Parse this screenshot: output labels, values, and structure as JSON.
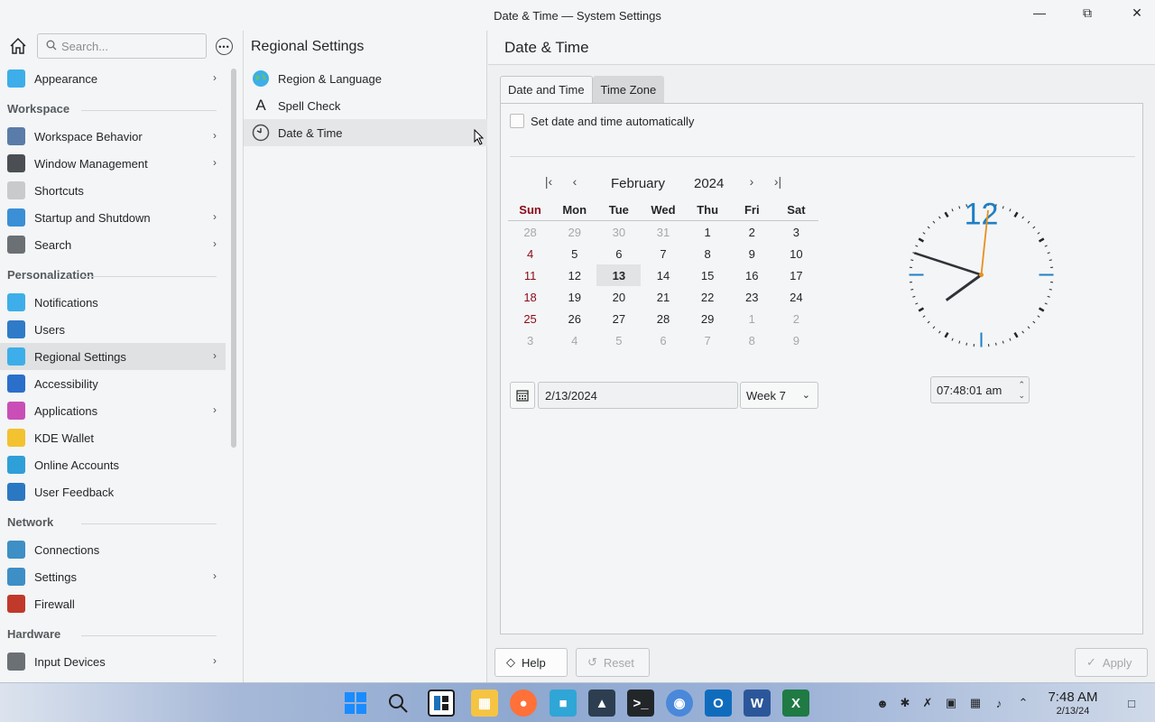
{
  "window": {
    "title": "Date & Time — System Settings",
    "minimize_icon": "minimize-icon",
    "maximize_icon": "restore-icon",
    "close_icon": "close-icon"
  },
  "sidebar": {
    "search_placeholder": "Search...",
    "top_items": [
      {
        "label": "Appearance",
        "icon": "appearance-icon",
        "color": "#3daee9",
        "chevron": true
      }
    ],
    "sections": [
      {
        "title": "Workspace",
        "items": [
          {
            "label": "Workspace Behavior",
            "icon": "workspace-behavior-icon",
            "color": "#5a7ca8",
            "chevron": true
          },
          {
            "label": "Window Management",
            "icon": "window-management-icon",
            "color": "#4b4f54",
            "chevron": true
          },
          {
            "label": "Shortcuts",
            "icon": "keyboard-icon",
            "color": "#c8cacc",
            "chevron": false
          },
          {
            "label": "Startup and Shutdown",
            "icon": "startup-icon",
            "color": "#3a8fd6",
            "chevron": true
          },
          {
            "label": "Search",
            "icon": "search-icon",
            "color": "#6b7075",
            "chevron": true
          }
        ]
      },
      {
        "title": "Personalization",
        "items": [
          {
            "label": "Notifications",
            "icon": "notifications-icon",
            "color": "#3daee9",
            "chevron": false
          },
          {
            "label": "Users",
            "icon": "users-icon",
            "color": "#2f7bc8",
            "chevron": false
          },
          {
            "label": "Regional Settings",
            "icon": "globe-icon",
            "color": "#3daee9",
            "chevron": true,
            "active": true
          },
          {
            "label": "Accessibility",
            "icon": "accessibility-icon",
            "color": "#2a6fc9",
            "chevron": false
          },
          {
            "label": "Applications",
            "icon": "applications-icon",
            "color": "#c94fb6",
            "chevron": true
          },
          {
            "label": "KDE Wallet",
            "icon": "wallet-icon",
            "color": "#f2c230",
            "chevron": false
          },
          {
            "label": "Online Accounts",
            "icon": "online-accounts-icon",
            "color": "#2f9fd8",
            "chevron": false
          },
          {
            "label": "User Feedback",
            "icon": "feedback-icon",
            "color": "#2b78c2",
            "chevron": false
          }
        ]
      },
      {
        "title": "Network",
        "items": [
          {
            "label": "Connections",
            "icon": "connections-icon",
            "color": "#3d8fc6",
            "chevron": false
          },
          {
            "label": "Settings",
            "icon": "network-settings-icon",
            "color": "#3d8fc6",
            "chevron": true
          },
          {
            "label": "Firewall",
            "icon": "firewall-icon",
            "color": "#c0392b",
            "chevron": false
          }
        ]
      },
      {
        "title": "Hardware",
        "items": [
          {
            "label": "Input Devices",
            "icon": "input-devices-icon",
            "color": "#6b7075",
            "chevron": true
          }
        ]
      }
    ]
  },
  "regional": {
    "title": "Regional Settings",
    "items": [
      {
        "label": "Region & Language",
        "icon": "globe-icon",
        "active": false
      },
      {
        "label": "Spell Check",
        "icon": "spell-check-icon",
        "active": false
      },
      {
        "label": "Date & Time",
        "icon": "clock-icon",
        "active": true
      }
    ]
  },
  "main": {
    "title": "Date & Time",
    "tabs": [
      {
        "label": "Date and Time",
        "active": true
      },
      {
        "label": "Time Zone",
        "active": false
      }
    ],
    "auto_label": "Set date and time automatically",
    "calendar": {
      "month": "February",
      "year": "2024",
      "weekdays": [
        "Sun",
        "Mon",
        "Tue",
        "Wed",
        "Thu",
        "Fri",
        "Sat"
      ],
      "weeks": [
        [
          "28",
          "29",
          "30",
          "31",
          "1",
          "2",
          "3"
        ],
        [
          "4",
          "5",
          "6",
          "7",
          "8",
          "9",
          "10"
        ],
        [
          "11",
          "12",
          "13",
          "14",
          "15",
          "16",
          "17"
        ],
        [
          "18",
          "19",
          "20",
          "21",
          "22",
          "23",
          "24"
        ],
        [
          "25",
          "26",
          "27",
          "28",
          "29",
          "1",
          "2"
        ],
        [
          "3",
          "4",
          "5",
          "6",
          "7",
          "8",
          "9"
        ]
      ],
      "today": "13",
      "date_value": "2/13/2024",
      "week_value": "Week 7"
    },
    "clock": {
      "twelve_label": "12",
      "hour": 7,
      "minute": 48,
      "second": 1
    },
    "time_value": "07:48:01 am",
    "help_label": "Help",
    "reset_label": "Reset",
    "apply_label": "Apply"
  },
  "taskbar": {
    "apps": [
      "start-icon",
      "search-icon",
      "widgets-icon",
      "file-explorer-icon",
      "firefox-icon",
      "pycharm-icon",
      "photos-icon",
      "terminal-icon",
      "chrome-icon",
      "outlook-icon",
      "word-icon",
      "excel-icon"
    ],
    "time": "7:48 AM",
    "date": "2/13/24"
  }
}
